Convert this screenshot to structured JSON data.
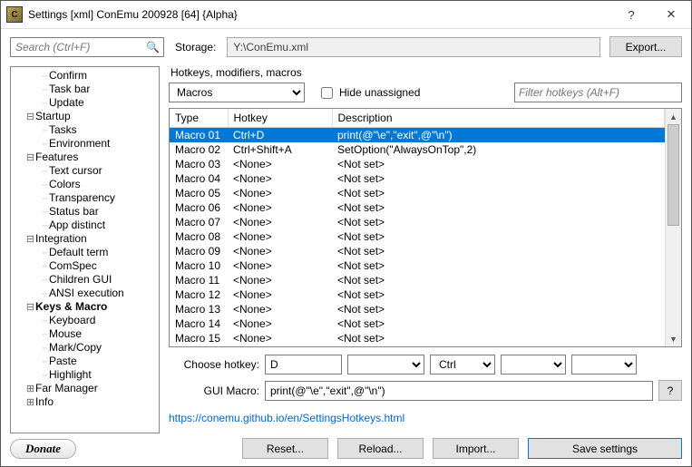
{
  "window": {
    "title": "Settings [xml] ConEmu 200928 [64] {Alpha}"
  },
  "storage": {
    "label": "Storage:",
    "path": "Y:\\ConEmu.xml",
    "export_btn": "Export..."
  },
  "search": {
    "placeholder": "Search (Ctrl+F)"
  },
  "tree": [
    {
      "depth": 2,
      "label": "Confirm"
    },
    {
      "depth": 2,
      "label": "Task bar"
    },
    {
      "depth": 2,
      "label": "Update"
    },
    {
      "depth": 1,
      "label": "Startup",
      "expand": "minus"
    },
    {
      "depth": 2,
      "label": "Tasks"
    },
    {
      "depth": 2,
      "label": "Environment"
    },
    {
      "depth": 1,
      "label": "Features",
      "expand": "minus"
    },
    {
      "depth": 2,
      "label": "Text cursor"
    },
    {
      "depth": 2,
      "label": "Colors"
    },
    {
      "depth": 2,
      "label": "Transparency"
    },
    {
      "depth": 2,
      "label": "Status bar"
    },
    {
      "depth": 2,
      "label": "App distinct"
    },
    {
      "depth": 1,
      "label": "Integration",
      "expand": "minus"
    },
    {
      "depth": 2,
      "label": "Default term"
    },
    {
      "depth": 2,
      "label": "ComSpec"
    },
    {
      "depth": 2,
      "label": "Children GUI"
    },
    {
      "depth": 2,
      "label": "ANSI execution"
    },
    {
      "depth": 1,
      "label": "Keys & Macro",
      "expand": "minus",
      "bold": true
    },
    {
      "depth": 2,
      "label": "Keyboard"
    },
    {
      "depth": 2,
      "label": "Mouse"
    },
    {
      "depth": 2,
      "label": "Mark/Copy"
    },
    {
      "depth": 2,
      "label": "Paste"
    },
    {
      "depth": 2,
      "label": "Highlight"
    },
    {
      "depth": 1,
      "label": "Far Manager",
      "expand": "plus"
    },
    {
      "depth": 1,
      "label": "Info",
      "expand": "plus"
    }
  ],
  "donate": {
    "label": "Donate"
  },
  "panel": {
    "group_label": "Hotkeys, modifiers, macros",
    "category_select": "Macros",
    "hide_unassigned": "Hide unassigned",
    "filter_placeholder": "Filter hotkeys (Alt+F)",
    "columns": {
      "type": "Type",
      "hotkey": "Hotkey",
      "desc": "Description"
    },
    "rows": [
      {
        "type": "Macro 01",
        "hotkey": "Ctrl+D",
        "desc": "print(@\"\\e\",\"exit\",@\"\\n\")",
        "selected": true
      },
      {
        "type": "Macro 02",
        "hotkey": "Ctrl+Shift+A",
        "desc": "SetOption(\"AlwaysOnTop\",2)"
      },
      {
        "type": "Macro 03",
        "hotkey": "<None>",
        "desc": "<Not set>"
      },
      {
        "type": "Macro 04",
        "hotkey": "<None>",
        "desc": "<Not set>"
      },
      {
        "type": "Macro 05",
        "hotkey": "<None>",
        "desc": "<Not set>"
      },
      {
        "type": "Macro 06",
        "hotkey": "<None>",
        "desc": "<Not set>"
      },
      {
        "type": "Macro 07",
        "hotkey": "<None>",
        "desc": "<Not set>"
      },
      {
        "type": "Macro 08",
        "hotkey": "<None>",
        "desc": "<Not set>"
      },
      {
        "type": "Macro 09",
        "hotkey": "<None>",
        "desc": "<Not set>"
      },
      {
        "type": "Macro 10",
        "hotkey": "<None>",
        "desc": "<Not set>"
      },
      {
        "type": "Macro 11",
        "hotkey": "<None>",
        "desc": "<Not set>"
      },
      {
        "type": "Macro 12",
        "hotkey": "<None>",
        "desc": "<Not set>"
      },
      {
        "type": "Macro 13",
        "hotkey": "<None>",
        "desc": "<Not set>"
      },
      {
        "type": "Macro 14",
        "hotkey": "<None>",
        "desc": "<Not set>"
      },
      {
        "type": "Macro 15",
        "hotkey": "<None>",
        "desc": "<Not set>"
      }
    ],
    "choose_label": "Choose hotkey:",
    "choose_value": "D",
    "mod1": "",
    "mod2": "Ctrl",
    "mod3": "",
    "mod4": "",
    "gui_label": "GUI Macro:",
    "gui_value": "print(@\"\\e\",\"exit\",@\"\\n\")",
    "help_btn": "?",
    "help_link": "https://conemu.github.io/en/SettingsHotkeys.html"
  },
  "footer": {
    "reset": "Reset...",
    "reload": "Reload...",
    "import": "Import...",
    "save": "Save settings"
  }
}
